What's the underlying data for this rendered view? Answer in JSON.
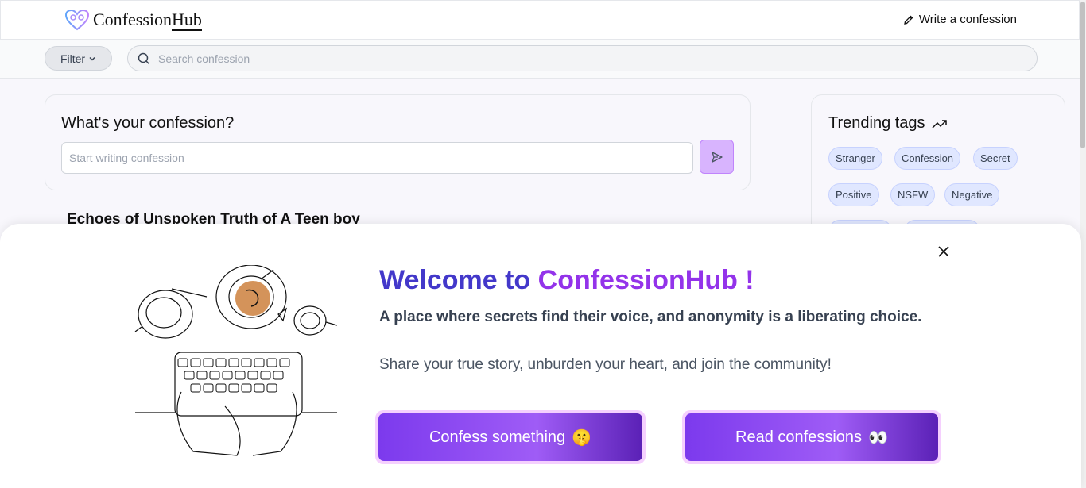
{
  "header": {
    "logo_text_part1": "Confession",
    "logo_text_part2": "Hub",
    "write_link": "Write a confession"
  },
  "toolbar": {
    "filter_label": "Filter",
    "search_placeholder": "Search confession"
  },
  "compose": {
    "title": "What's your confession?",
    "placeholder": "Start writing confession"
  },
  "feed": {
    "first_post_title": "Echoes of Unspoken Truth of A Teen boy"
  },
  "trending": {
    "title": "Trending tags",
    "tags": [
      "Stranger",
      "Confession",
      "Secret",
      "Positive",
      "NSFW",
      "Negative"
    ]
  },
  "modal": {
    "welcome_prefix": "Welcome to ",
    "welcome_brand": "ConfessionHub !",
    "tagline": "A place where secrets find their voice, and anonymity is a liberating choice.",
    "subline": "Share your true story, unburden your heart, and join the community!",
    "confess_button": "Confess something",
    "confess_emoji": "🤫",
    "read_button": "Read confessions",
    "read_emoji": "👀"
  },
  "colors": {
    "accent_purple": "#7c3aed",
    "welcome_indigo": "#4338ca",
    "welcome_violet": "#9333ea",
    "tag_bg": "#e0e7ff"
  }
}
